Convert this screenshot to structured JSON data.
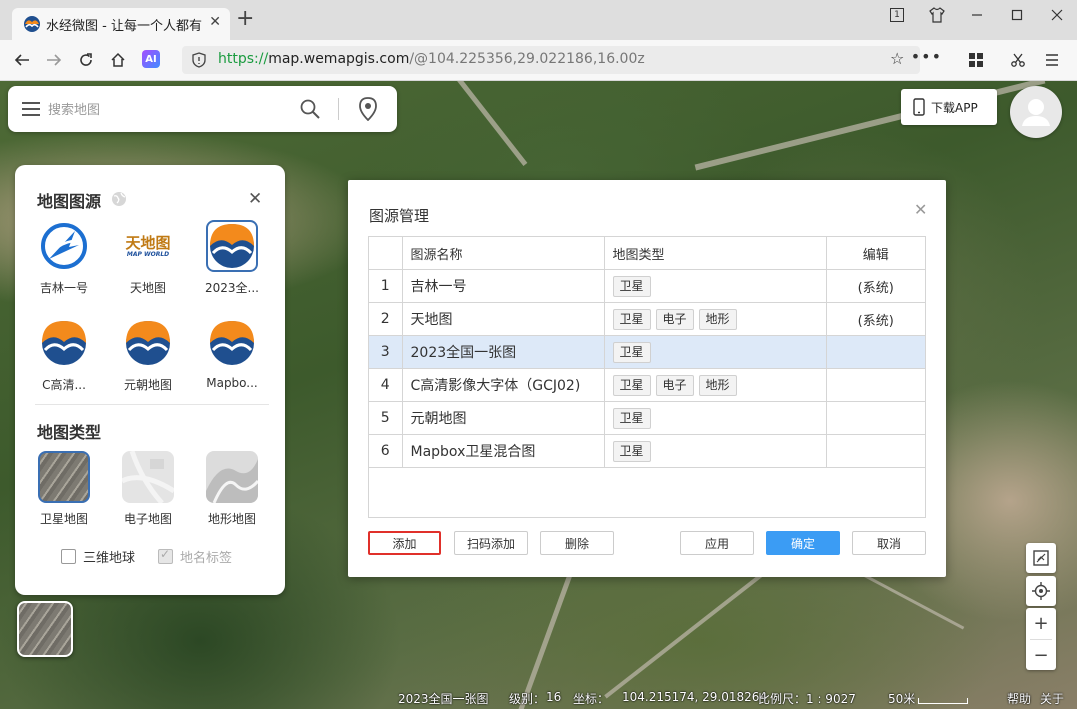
{
  "browser": {
    "tab_title": "水经微图 - 让每一个人都有自",
    "tab_close": "✕",
    "new_tab": "+",
    "url_proto": "https://",
    "url_host": "map.wemapgis.com",
    "url_path": "/@104.225356,29.022186,16.00z",
    "ai_label": "AI",
    "window_badge": "1"
  },
  "search": {
    "placeholder": "搜索地图"
  },
  "download_app": "下载APP",
  "source_panel": {
    "title": "地图图源",
    "close": "✕",
    "sources": [
      {
        "label": "吉林一号",
        "icon": "jilin1-logo"
      },
      {
        "label": "天地图",
        "icon": "tianditu-logo",
        "logo_text": "天地图",
        "logo_sub": "MAP WORLD"
      },
      {
        "label": "2023全...",
        "icon": "wemap-logo",
        "selected": true
      },
      {
        "label": "C高清...",
        "icon": "wemap-logo"
      },
      {
        "label": "元朝地图",
        "icon": "wemap-logo"
      },
      {
        "label": "Mapbo...",
        "icon": "wemap-logo"
      }
    ],
    "type_title": "地图类型",
    "types": [
      {
        "label": "卫星地图",
        "selected": true
      },
      {
        "label": "电子地图"
      },
      {
        "label": "地形地图"
      }
    ],
    "globe_3d": "三维地球",
    "place_labels": "地名标签"
  },
  "dialog": {
    "title": "图源管理",
    "close": "✕",
    "headers": {
      "name": "图源名称",
      "type": "地图类型",
      "edit": "编辑"
    },
    "rows": [
      {
        "idx": "1",
        "name": "吉林一号",
        "types": [
          "卫星"
        ],
        "edit": "(系统)"
      },
      {
        "idx": "2",
        "name": "天地图",
        "types": [
          "卫星",
          "电子",
          "地形"
        ],
        "edit": "(系统)"
      },
      {
        "idx": "3",
        "name": "2023全国一张图",
        "types": [
          "卫星"
        ],
        "edit": "",
        "selected": true
      },
      {
        "idx": "4",
        "name": "C高清影像大字体（GCJ02)",
        "types": [
          "卫星",
          "电子",
          "地形"
        ],
        "edit": ""
      },
      {
        "idx": "5",
        "name": "元朝地图",
        "types": [
          "卫星"
        ],
        "edit": ""
      },
      {
        "idx": "6",
        "name": "Mapbox卫星混合图",
        "types": [
          "卫星"
        ],
        "edit": ""
      }
    ],
    "buttons": {
      "add": "添加",
      "scan_add": "扫码添加",
      "delete": "删除",
      "apply": "应用",
      "ok": "确定",
      "cancel": "取消"
    }
  },
  "controls": {
    "zoom_in": "+",
    "zoom_out": "−"
  },
  "status": {
    "source": "2023全国一张图",
    "level_label": "级别：",
    "level": "16",
    "coord_label": "坐标：",
    "coord": "104.215174, 29.018264",
    "scale_label": "比例尺：1 : 9027",
    "scale_text": "50米",
    "help": "帮助",
    "about": "关于"
  },
  "colors": {
    "accent": "#3b9cf4",
    "highlight_border": "#e0302a",
    "selected_row": "#dde9f8",
    "url_green": "#1a9b3f"
  }
}
